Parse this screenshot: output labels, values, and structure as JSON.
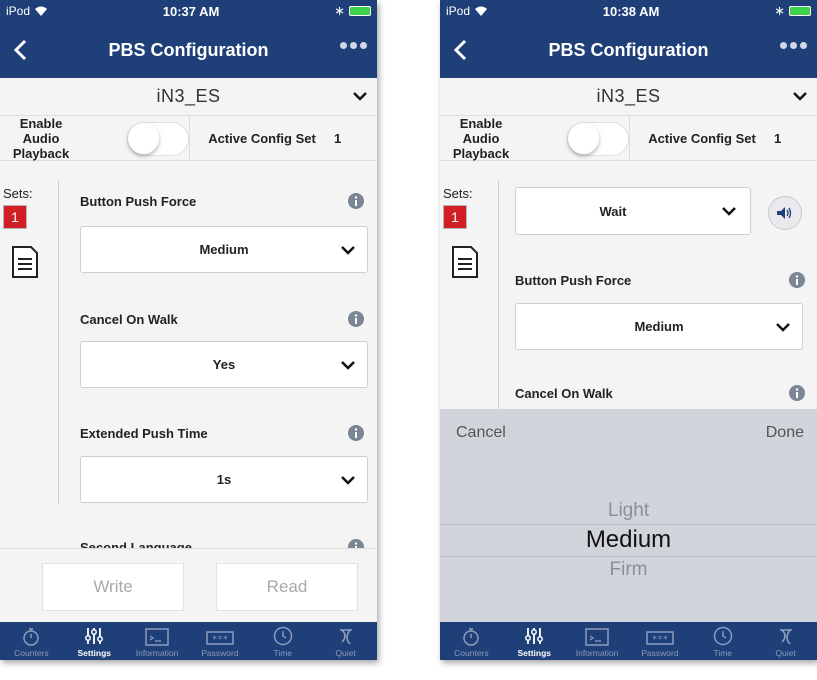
{
  "status_bars": [
    {
      "carrier": "iPod",
      "time": "10:37 AM"
    },
    {
      "carrier": "iPod",
      "time": "10:38 AM"
    }
  ],
  "navbar": {
    "title": "PBS Configuration"
  },
  "device": {
    "name": "iN3_ES"
  },
  "audio": {
    "label": "Enable Audio Playback",
    "enabled": false
  },
  "active_config": {
    "label": "Active Config Set",
    "value": "1"
  },
  "sets": {
    "label": "Sets:",
    "items": [
      "1"
    ]
  },
  "fields": {
    "button_push_force": {
      "label": "Button Push Force",
      "value": "Medium"
    },
    "cancel_on_walk": {
      "label": "Cancel On Walk",
      "value": "Yes"
    },
    "extended_push_time": {
      "label": "Extended Push Time",
      "value": "1s"
    },
    "second_language": {
      "label": "Second Language"
    },
    "message_dropdown": {
      "value": "Wait"
    }
  },
  "actions": {
    "write": "Write",
    "read": "Read"
  },
  "picker": {
    "cancel": "Cancel",
    "done": "Done",
    "options": [
      "Light",
      "Medium",
      "Firm"
    ],
    "selected": "Medium"
  },
  "tabs": [
    "Counters",
    "Settings",
    "Information",
    "Password",
    "Time",
    "Quiet"
  ],
  "active_tab": "Settings",
  "colors": {
    "nav": "#1f3f78",
    "set_badge": "#d11f25",
    "battery": "#3fd24a",
    "tab_inactive": "#8d9bbd"
  }
}
